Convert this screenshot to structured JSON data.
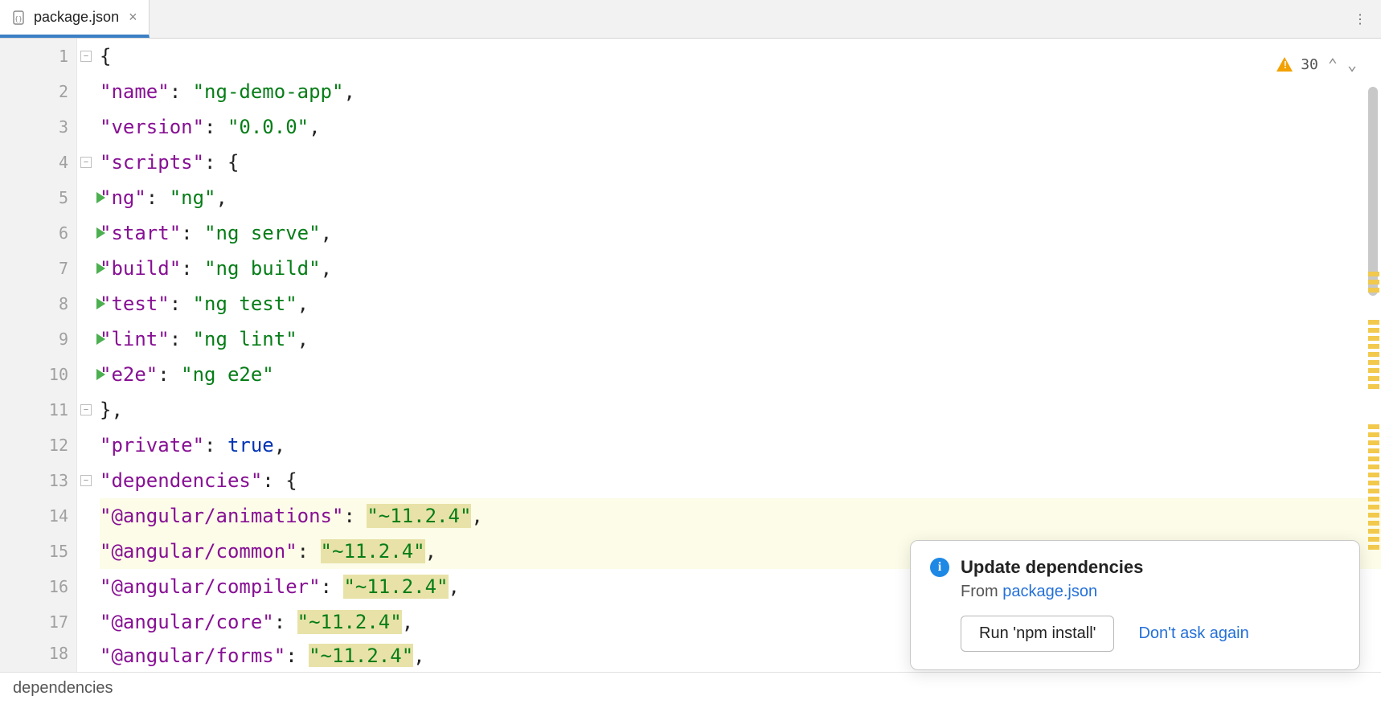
{
  "tab": {
    "filename": "package.json",
    "close_glyph": "×"
  },
  "more_glyph": "⋮",
  "inspection": {
    "warning_count": "30",
    "up": "⌃",
    "down": "⌄"
  },
  "gutter": {
    "lines": [
      "1",
      "2",
      "3",
      "4",
      "5",
      "6",
      "7",
      "8",
      "9",
      "10",
      "11",
      "12",
      "13",
      "14",
      "15",
      "16",
      "17",
      "18"
    ],
    "run_rows": [
      5,
      6,
      7,
      8,
      9,
      10
    ]
  },
  "code": {
    "l1": "{",
    "l2": {
      "k": "\"name\"",
      "v": "\"ng-demo-app\""
    },
    "l3": {
      "k": "\"version\"",
      "v": "\"0.0.0\""
    },
    "l4": {
      "k": "\"scripts\"",
      "brace": "{"
    },
    "l5": {
      "k": "\"ng\"",
      "v": "\"ng\""
    },
    "l6": {
      "k": "\"start\"",
      "v": "\"ng serve\""
    },
    "l7": {
      "k": "\"build\"",
      "v": "\"ng build\""
    },
    "l8": {
      "k": "\"test\"",
      "v": "\"ng test\""
    },
    "l9": {
      "k": "\"lint\"",
      "v": "\"ng lint\""
    },
    "l10": {
      "k": "\"e2e\"",
      "v": "\"ng e2e\""
    },
    "l11": "},",
    "l12": {
      "k": "\"private\"",
      "v": "true"
    },
    "l13": {
      "k": "\"dependencies\"",
      "brace": "{"
    },
    "l14": {
      "k": "\"@angular/animations\"",
      "v": "\"~11.2.4\""
    },
    "l15": {
      "k": "\"@angular/common\"",
      "v": "\"~11.2.4\""
    },
    "l16": {
      "k": "\"@angular/compiler\"",
      "v": "\"~11.2.4\""
    },
    "l17": {
      "k": "\"@angular/core\"",
      "v": "\"~11.2.4\""
    },
    "l18": {
      "k": "\"@angular/forms\"",
      "v": "\"~11.2.4\""
    }
  },
  "breadcrumb": "dependencies",
  "popup": {
    "title": "Update dependencies",
    "from_prefix": "From ",
    "from_link": "package.json",
    "run_button": "Run 'npm install'",
    "dont_ask": "Don't ask again"
  }
}
